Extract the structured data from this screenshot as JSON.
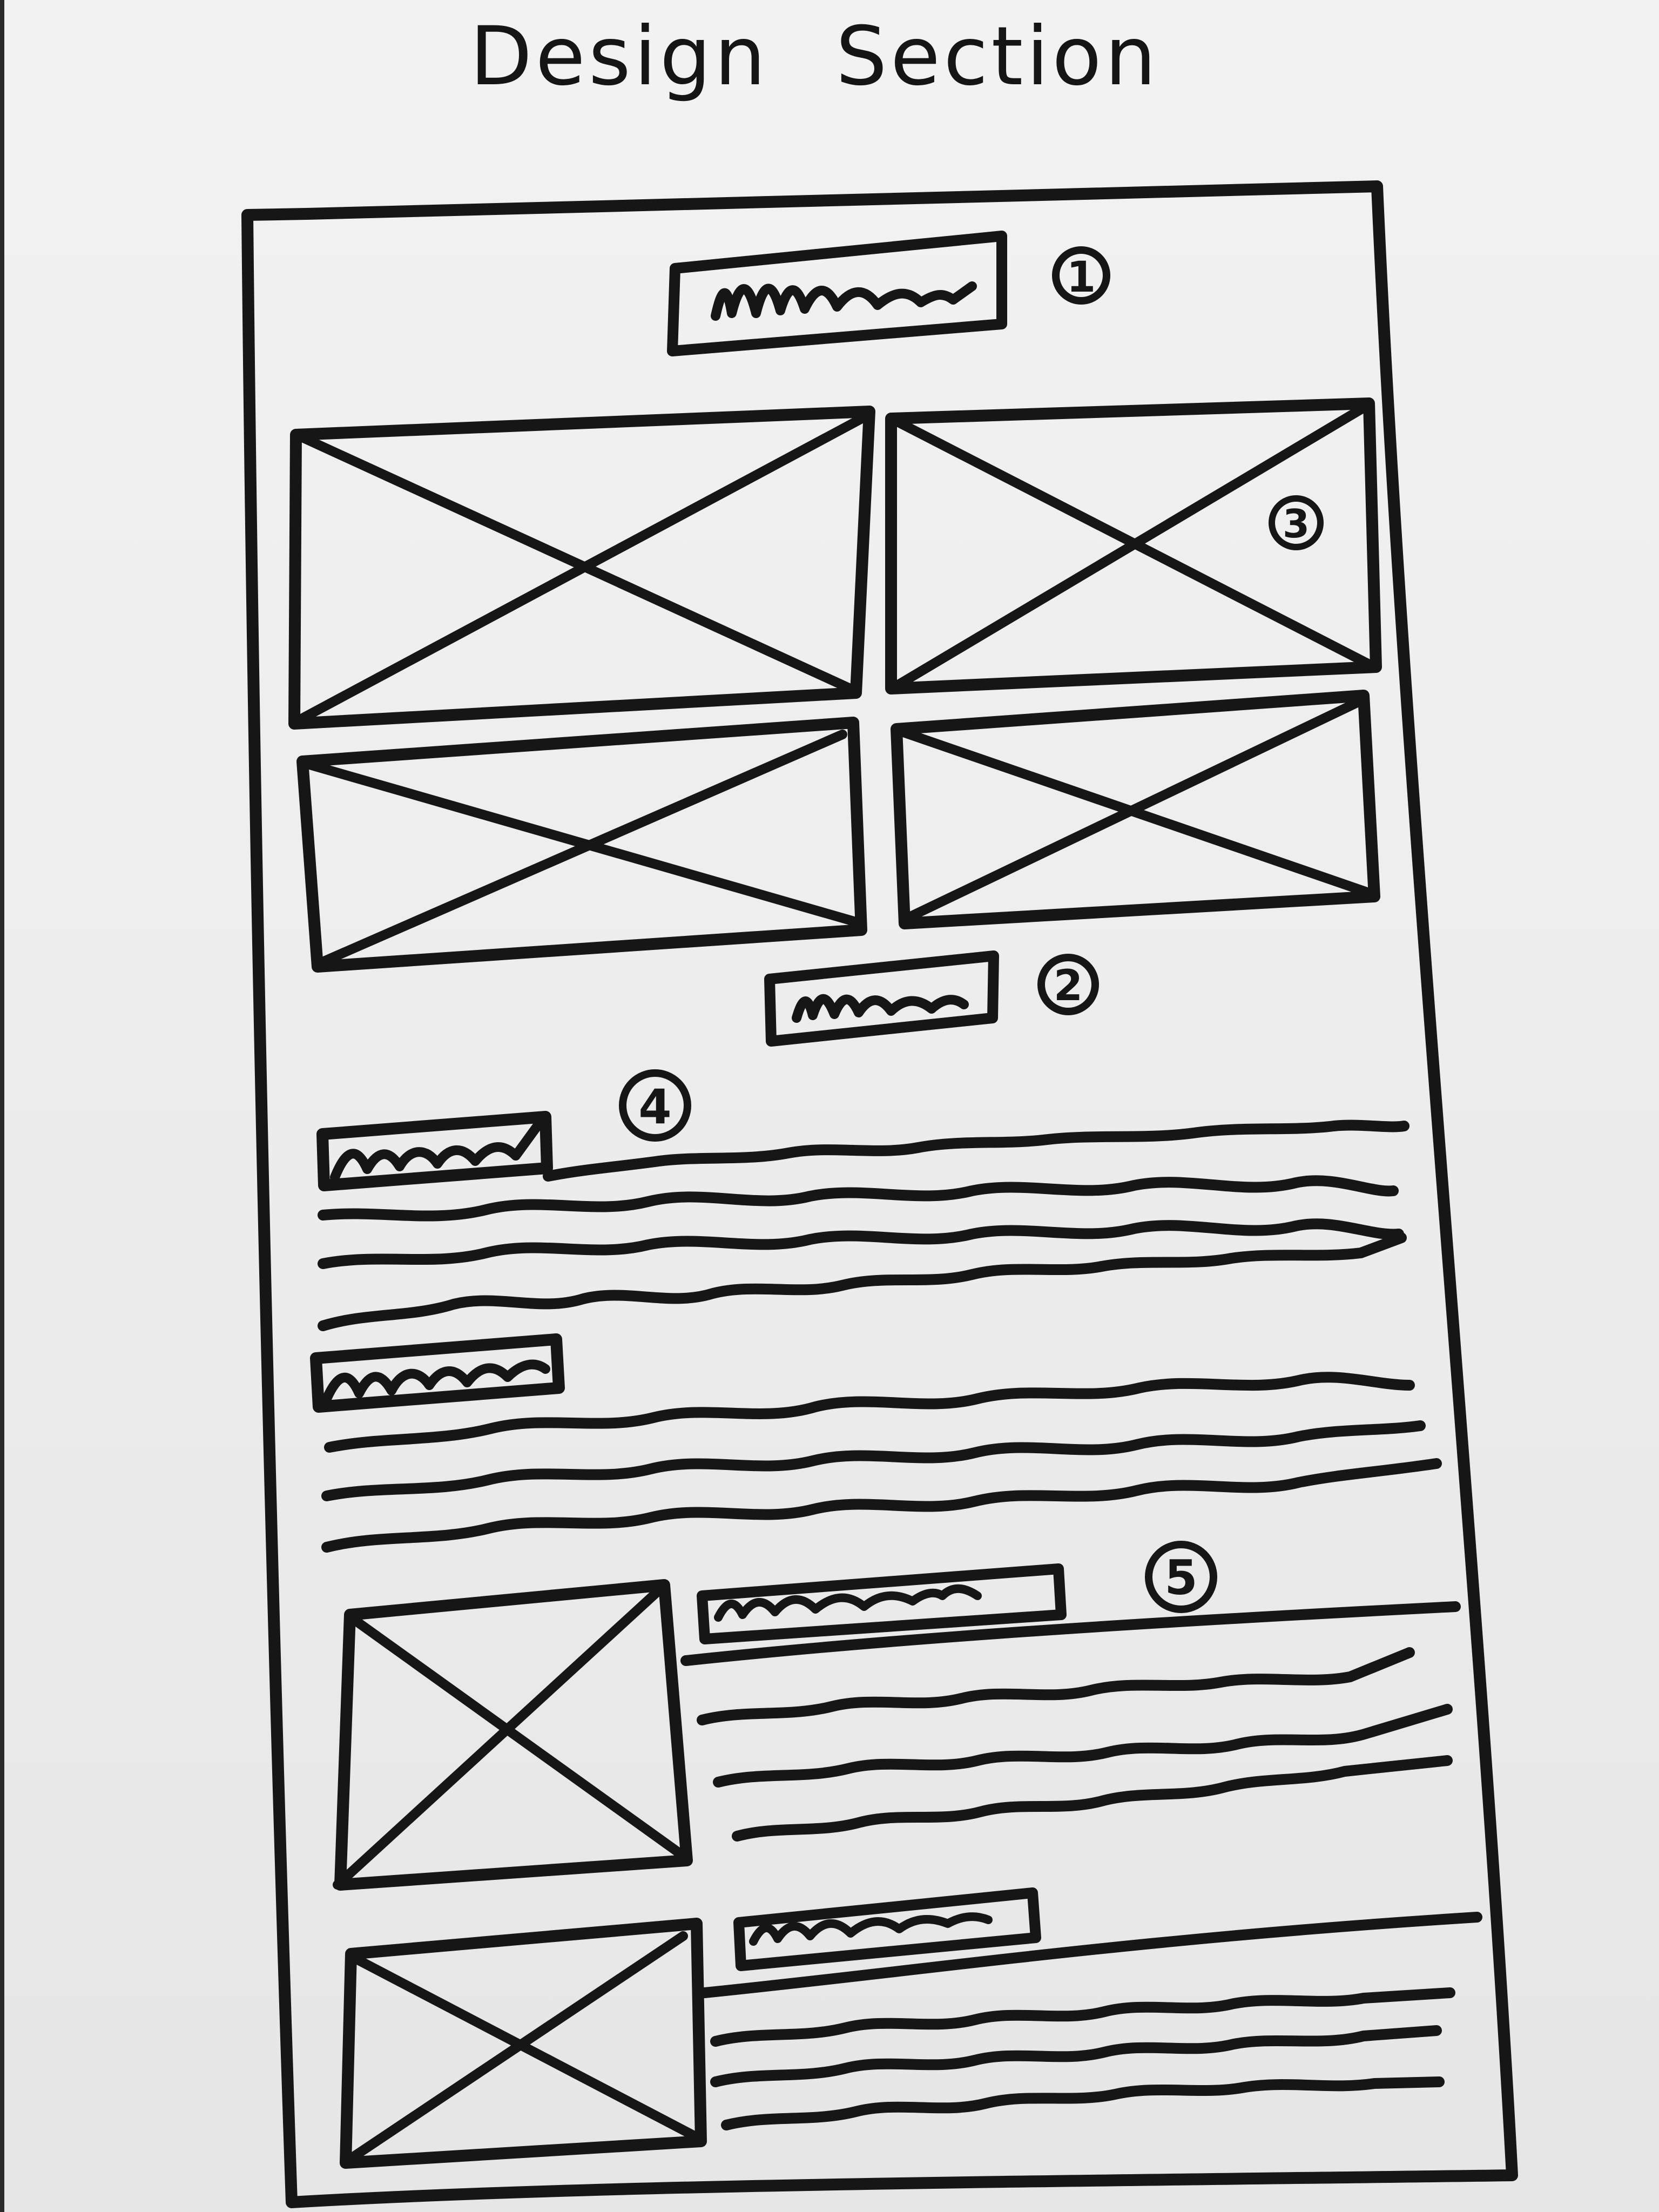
{
  "title": "Design Section",
  "colors": {
    "paper": "#ededed",
    "ink": "#161616"
  },
  "annotations": {
    "header_section": "1",
    "section_heading_2": "2",
    "image_grid": "3",
    "text_sections": "4",
    "media_list": "5"
  },
  "icons": {
    "image_placeholder": "crossed-box-icon",
    "text_placeholder": "scribble-line"
  }
}
